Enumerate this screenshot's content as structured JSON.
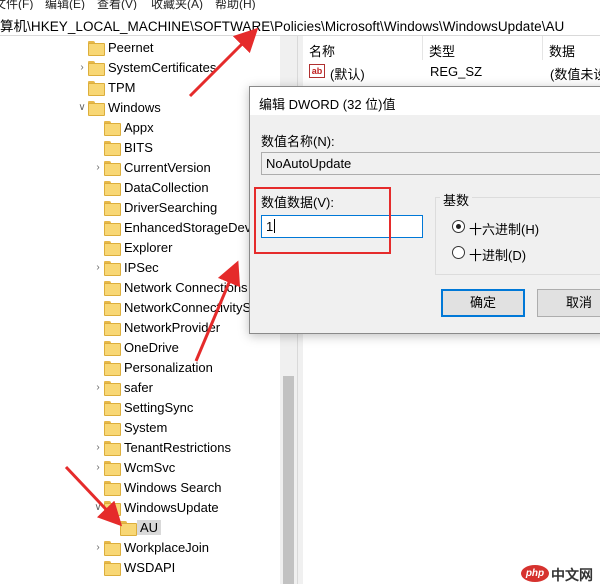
{
  "menu": [
    "文件(F)",
    "编辑(E)",
    "查看(V)",
    "收藏夹(A)",
    "帮助(H)"
  ],
  "address": "算机\\HKEY_LOCAL_MACHINE\\SOFTWARE\\Policies\\Microsoft\\Windows\\WindowsUpdate\\AU",
  "tree": [
    {
      "label": "Peernet",
      "indent": 1,
      "chevron": false
    },
    {
      "label": "SystemCertificates",
      "indent": 1,
      "chevron": true,
      "expanded": false
    },
    {
      "label": "TPM",
      "indent": 1,
      "chevron": false
    },
    {
      "label": "Windows",
      "indent": 1,
      "chevron": true,
      "expanded": true
    },
    {
      "label": "Appx",
      "indent": 2,
      "chevron": false
    },
    {
      "label": "BITS",
      "indent": 2,
      "chevron": false
    },
    {
      "label": "CurrentVersion",
      "indent": 2,
      "chevron": true,
      "expanded": false
    },
    {
      "label": "DataCollection",
      "indent": 2,
      "chevron": false
    },
    {
      "label": "DriverSearching",
      "indent": 2,
      "chevron": false
    },
    {
      "label": "EnhancedStorageDevi",
      "indent": 2,
      "chevron": false
    },
    {
      "label": "Explorer",
      "indent": 2,
      "chevron": false
    },
    {
      "label": "IPSec",
      "indent": 2,
      "chevron": true,
      "expanded": false
    },
    {
      "label": "Network Connections",
      "indent": 2,
      "chevron": false
    },
    {
      "label": "NetworkConnectivityS",
      "indent": 2,
      "chevron": false
    },
    {
      "label": "NetworkProvider",
      "indent": 2,
      "chevron": false
    },
    {
      "label": "OneDrive",
      "indent": 2,
      "chevron": false
    },
    {
      "label": "Personalization",
      "indent": 2,
      "chevron": false
    },
    {
      "label": "safer",
      "indent": 2,
      "chevron": true,
      "expanded": false
    },
    {
      "label": "SettingSync",
      "indent": 2,
      "chevron": false
    },
    {
      "label": "System",
      "indent": 2,
      "chevron": false
    },
    {
      "label": "TenantRestrictions",
      "indent": 2,
      "chevron": true,
      "expanded": false
    },
    {
      "label": "WcmSvc",
      "indent": 2,
      "chevron": true,
      "expanded": false
    },
    {
      "label": "Windows Search",
      "indent": 2,
      "chevron": false
    },
    {
      "label": "WindowsUpdate",
      "indent": 2,
      "chevron": true,
      "expanded": true
    },
    {
      "label": "AU",
      "indent": 3,
      "chevron": false,
      "selected": true
    },
    {
      "label": "WorkplaceJoin",
      "indent": 2,
      "chevron": true,
      "expanded": false
    },
    {
      "label": "WSDAPI",
      "indent": 2,
      "chevron": false
    }
  ],
  "values": {
    "headers": {
      "name": "名称",
      "type": "类型",
      "data": "数据"
    },
    "rows": [
      {
        "name": "(默认)",
        "type": "REG_SZ",
        "data": "(数值未设"
      }
    ]
  },
  "dialog": {
    "title": "编辑 DWORD (32 位)值",
    "name_label": "数值名称(N):",
    "name_value": "NoAutoUpdate",
    "data_label": "数值数据(V):",
    "data_value": "1",
    "base_label": "基数",
    "radio_hex": "十六进制(H)",
    "radio_dec": "十进制(D)",
    "selected_base": "hex",
    "ok_label": "确定",
    "cancel_label": "取消"
  },
  "watermark": {
    "logo": "php",
    "text": "中文网"
  },
  "colors": {
    "annotation": "#e52b2b",
    "accent": "#0078d7",
    "folder": "#f8d775"
  }
}
